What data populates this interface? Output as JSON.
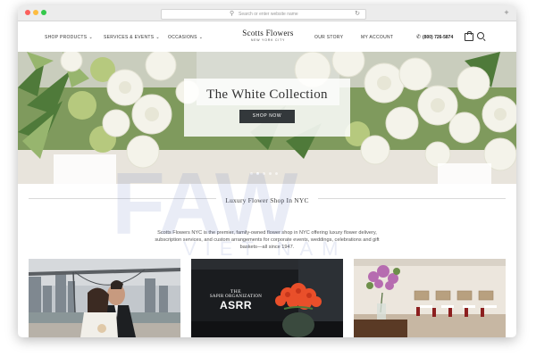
{
  "browser": {
    "address_placeholder": "Search or enter website name"
  },
  "nav": {
    "items": [
      {
        "label": "SHOP PRODUCTS"
      },
      {
        "label": "SERVICES & EVENTS"
      },
      {
        "label": "OCCASIONS"
      },
      {
        "label": "OUR STORY"
      },
      {
        "label": "MY ACCOUNT"
      }
    ],
    "logo_name": "Scotts Flowers",
    "logo_sub": "NEW YORK CITY",
    "phone": "(800) 726-5874"
  },
  "hero": {
    "title": "The White Collection",
    "button": "SHOP NOW"
  },
  "section": {
    "title": "Luxury Flower Shop In NYC",
    "intro": "Scotts Flowers NYC is the premier, family-owned flower shop in NYC offering luxury flower delivery, subscription services, and custom arrangements for corporate events, weddings, celebrations and gift baskets—all since 1947."
  },
  "photos": {
    "sign_line1": "THE",
    "sign_line2": "SAPIR ORGANIZATION",
    "sign_line3": "ASRR"
  },
  "watermark": {
    "main": "FAW",
    "sub": "VIET NAM"
  },
  "colors": {
    "hero_button": "#33383b",
    "nav_text": "#333333",
    "watermark": "#4664b4"
  }
}
